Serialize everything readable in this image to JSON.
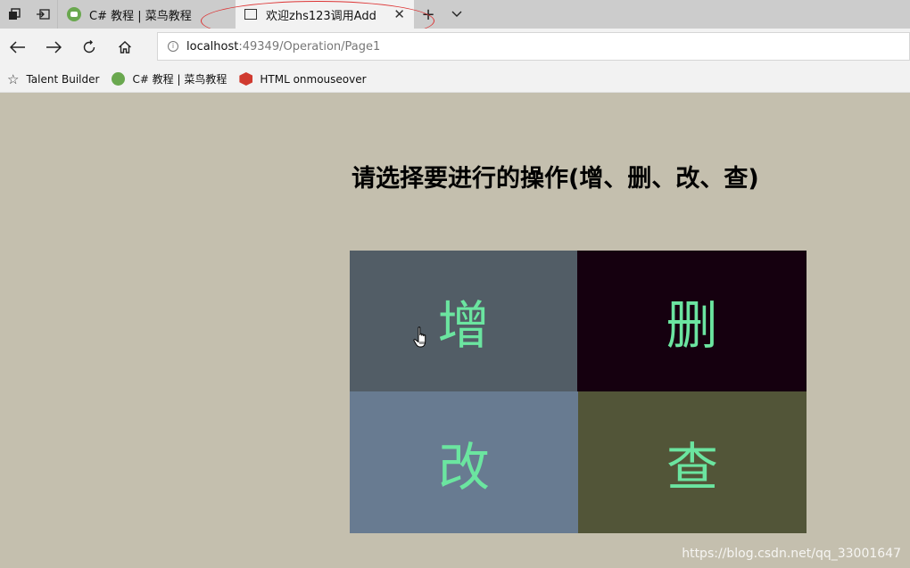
{
  "browser": {
    "tabs": [
      {
        "title": "C# 教程 | 菜鸟教程",
        "active": false
      },
      {
        "title": "欢迎zhs123调用Add",
        "active": true
      }
    ],
    "address": {
      "host": "localhost",
      "path": ":49349/Operation/Page1"
    },
    "favorites": [
      {
        "label": "Talent Builder"
      },
      {
        "label": "C# 教程 | 菜鸟教程"
      },
      {
        "label": "HTML onmouseover"
      }
    ],
    "info_icon": "i"
  },
  "page": {
    "title": "请选择要进行的操作(增、删、改、查)",
    "actions": {
      "add": "增",
      "delete": "删",
      "edit": "改",
      "query": "查"
    }
  },
  "watermark": "https://blog.csdn.net/qq_33001647",
  "colors": {
    "background": "#c4bfae",
    "add_cell": "#525d66",
    "delete_cell": "#15000f",
    "edit_cell": "#687b91",
    "query_cell": "#525538",
    "action_text": "#6be5a0",
    "annotation": "#dd3333"
  },
  "icons": {
    "tab_actions": "tab-actions-icon",
    "set_aside": "set-aside-tabs-icon",
    "back": "back-arrow-icon",
    "forward": "forward-arrow-icon",
    "refresh": "refresh-icon",
    "home": "home-icon",
    "new_tab": "plus-icon",
    "tab_list": "chevron-down-icon",
    "close": "close-icon",
    "favorite": "star-icon",
    "cursor": "hand-pointer-icon"
  }
}
